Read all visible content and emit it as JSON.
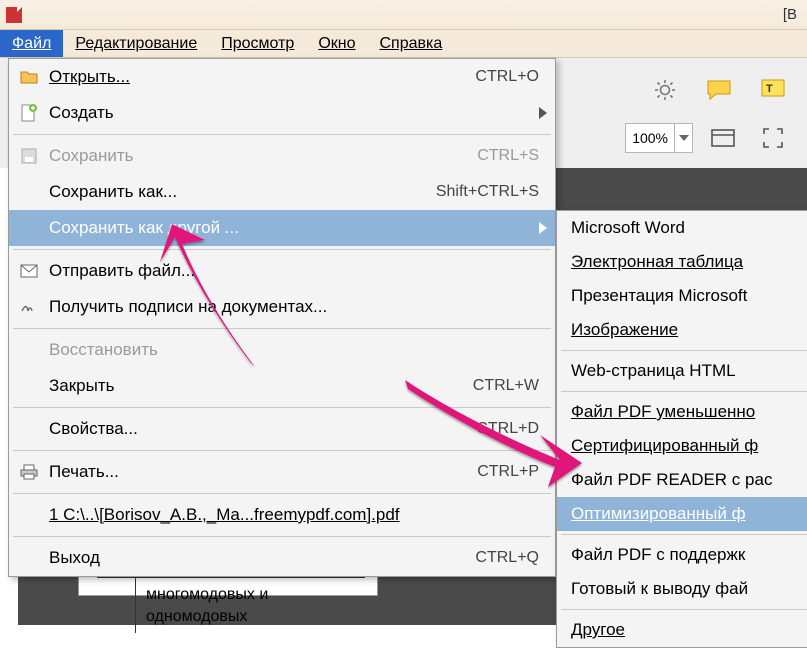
{
  "title_right": "[В",
  "menubar": {
    "file": "Файл",
    "edit": "Редактирование",
    "view": "Просмотр",
    "window": "Окно",
    "help": "Справка"
  },
  "zoom": "100%",
  "dropdown": {
    "open": "Открыть...",
    "open_sc": "CTRL+O",
    "create": "Создать",
    "save": "Сохранить",
    "save_sc": "CTRL+S",
    "saveas": "Сохранить как...",
    "saveas_sc": "Shift+CTRL+S",
    "saveother": "Сохранить как другой ...",
    "send": "Отправить файл...",
    "sign": "Получить подписи на документах...",
    "restore": "Восстановить",
    "close": "Закрыть",
    "close_sc": "CTRL+W",
    "props": "Свойства...",
    "props_sc": "CTRL+D",
    "print": "Печать...",
    "print_sc": "CTRL+P",
    "recent": "1 C:\\..\\[Borisov_A.B.,_Ma...freemypdf.com].pdf",
    "exit": "Выход",
    "exit_sc": "CTRL+Q"
  },
  "submenu": {
    "word": "Microsoft Word",
    "sheet": "Электронная таблица",
    "ppt": "Презентация Microsoft",
    "image": "Изображение",
    "web": "Web-страница HTML",
    "pdfsmall": "Файл PDF уменьшенно",
    "cert": "Сертифицированный ф",
    "reader": "Файл PDF READER с рас",
    "optimized": "Оптимизированный ф",
    "support": "Файл PDF с поддержк",
    "ready": "Готовый к выводу фай",
    "other": "Другое"
  },
  "page_text": "многомодовых и одномодовых",
  "colors": {
    "highlight": "#90b4d8",
    "activemenu": "#2b66c9",
    "arrow": "#e0197a"
  }
}
